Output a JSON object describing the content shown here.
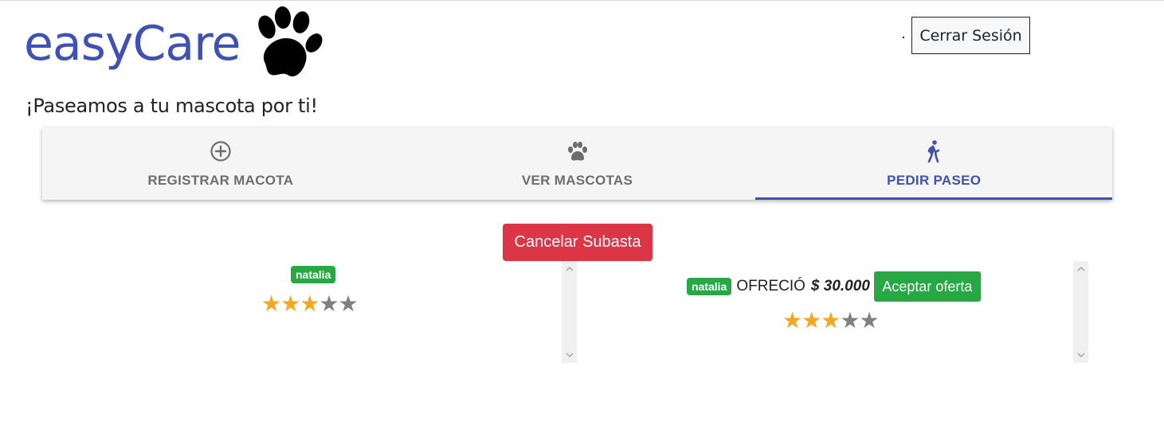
{
  "header": {
    "logo_text": "easyCare",
    "tagline": "¡Paseamos a tu mascota por ti!",
    "logout_label": "Cerrar Sesión"
  },
  "tabs": [
    {
      "label": "REGISTRAR MACOTA",
      "icon": "plus-circle-icon",
      "active": false
    },
    {
      "label": "VER MASCOTAS",
      "icon": "paw-icon",
      "active": false
    },
    {
      "label": "PEDIR PASEO",
      "icon": "walking-icon",
      "active": true
    }
  ],
  "auction": {
    "cancel_label": "Cancelar Subasta",
    "walkers": [
      {
        "name": "natalia",
        "rating": 3,
        "max_rating": 5
      }
    ],
    "offers": [
      {
        "name": "natalia",
        "offer_text": "OFRECIÓ",
        "amount": "$ 30.000",
        "accept_label": "Aceptar oferta",
        "rating": 3,
        "max_rating": 5
      }
    ]
  },
  "colors": {
    "brand": "#4051b5",
    "danger": "#dc3545",
    "success": "#28a745",
    "star_on": "#f5a623",
    "star_off": "#808080"
  }
}
